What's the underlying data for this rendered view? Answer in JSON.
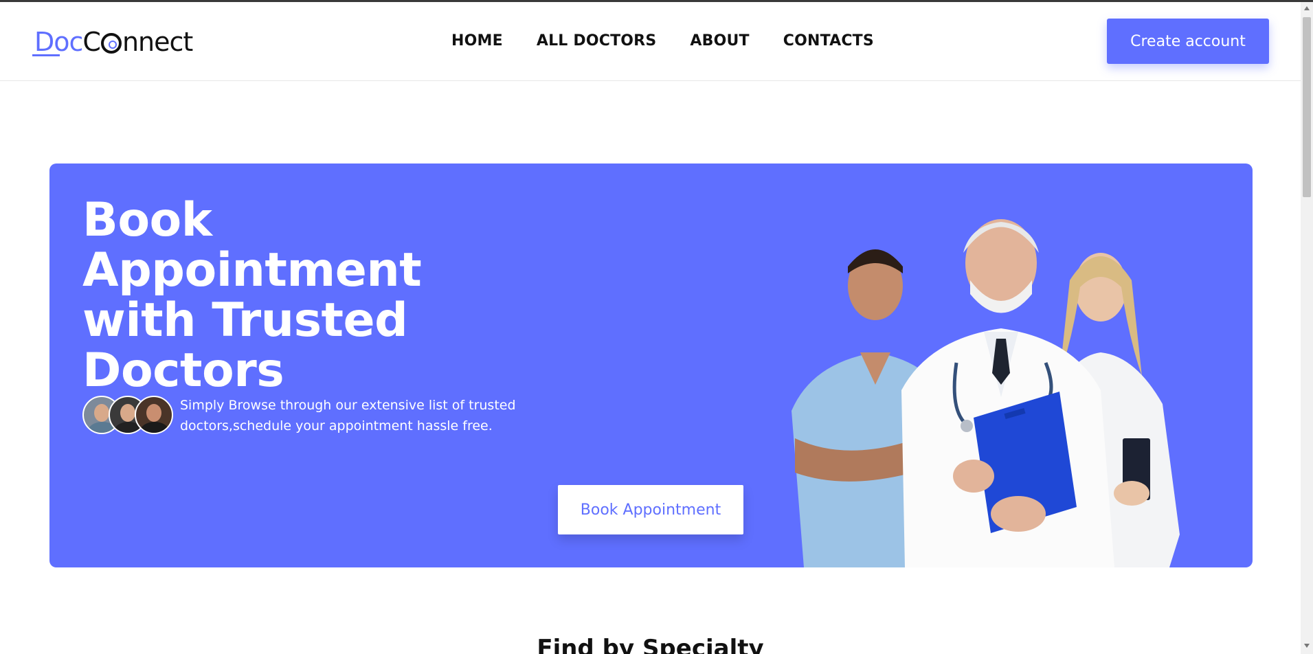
{
  "brand": {
    "name": "DocConnect",
    "part_d": "D",
    "part_oc": "oc",
    "part_c": "C",
    "part_nnect": "nnect",
    "accent_color": "#5f6fff"
  },
  "nav": {
    "items": [
      "HOME",
      "ALL DOCTORS",
      "ABOUT",
      "CONTACTS"
    ]
  },
  "header": {
    "create_account_label": "Create account"
  },
  "hero": {
    "title_lines": [
      "Book Appointment",
      "with Trusted",
      "Doctors"
    ],
    "description": "Simply Browse through our extensive list of trusted doctors,schedule your appointment hassle free.",
    "book_button_label": "Book Appointment",
    "avatar_icons": [
      "user-avatar",
      "user-avatar",
      "user-avatar"
    ],
    "image": "doctors-group-illustration"
  },
  "sections": {
    "specialty_title": "Find by Specialty"
  }
}
